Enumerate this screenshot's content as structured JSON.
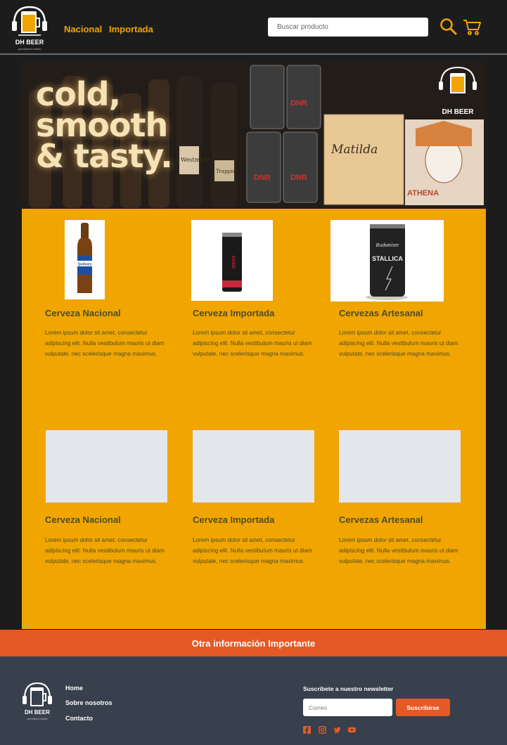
{
  "header": {
    "logo_text": "DH BEER",
    "logo_tagline": "specialized market",
    "nav": [
      "Nacional",
      "Importada"
    ],
    "search_placeholder": "Buscar producto",
    "icons": [
      "search-icon",
      "cart-icon"
    ]
  },
  "hero": {
    "title_lines": [
      "cold,",
      "smooth",
      "& tasty."
    ],
    "labels": [
      "Westmalle",
      "Trappist",
      "DNR",
      "Matilda",
      "ATHENA",
      "DH BEER"
    ]
  },
  "products_top": [
    {
      "title": "Cerveza Nacional",
      "text": "Lorem ipsum dolor sit amet, consectetur adipiscing elit. Nulla vestibulum mauris ut diam vulputate, nec scelerisque magna maximus."
    },
    {
      "title": "Cerveza Importada",
      "text": "Lorem ipsum dolor sit amet, consectetur adipiscing elit. Nulla vestibulum mauris ut diam vulputate, nec scelerisque magna maximus."
    },
    {
      "title": "Cervezas Artesanal",
      "text": "Lorem ipsum dolor sit amet, consectetur adipiscing elit. Nulla vestibulum mauris ut diam vulputate, nec scelerisque magna maximus."
    }
  ],
  "product_images": [
    {
      "label": "Quilmes"
    },
    {
      "label": "AC/DC"
    },
    {
      "label": "STALLICA"
    }
  ],
  "products_bottom": [
    {
      "title": "Cerveza Nacional",
      "text": "Lorem ipsum dolor sit amet, consectetur adipiscing elit. Nulla vestibulum mauris ut diam vulputate, nec scelerisque magna maximus."
    },
    {
      "title": "Cerveza Importada",
      "text": "Lorem ipsum dolor sit amet, consectetur adipiscing elit. Nulla vestibulum mauris ut diam vulputate, nec scelerisque magna maximus."
    },
    {
      "title": "Cervezas Artesanal",
      "text": "Lorem ipsum dolor sit amet, consectetur adipiscing elit. Nulla vestibulum mauris ut diam vulputate, nec scelerisque magna maximus."
    }
  ],
  "info_bar": "Otra información Importante",
  "footer": {
    "logo_text": "DH BEER",
    "logo_tagline": "specialized market",
    "links": [
      "Home",
      "Sobre nosotros",
      "Contacto"
    ],
    "newsletter_title": "Suscribete a nuestro newsletter",
    "email_placeholder": "Correo",
    "subscribe_label": "Suscribirse",
    "social": [
      "facebook-icon",
      "instagram-icon",
      "twitter-icon",
      "youtube-icon"
    ]
  },
  "colors": {
    "accent": "#f0a500",
    "orange": "#e45a27",
    "footer_bg": "#37404c",
    "dark_bg": "#1c1c1c"
  }
}
